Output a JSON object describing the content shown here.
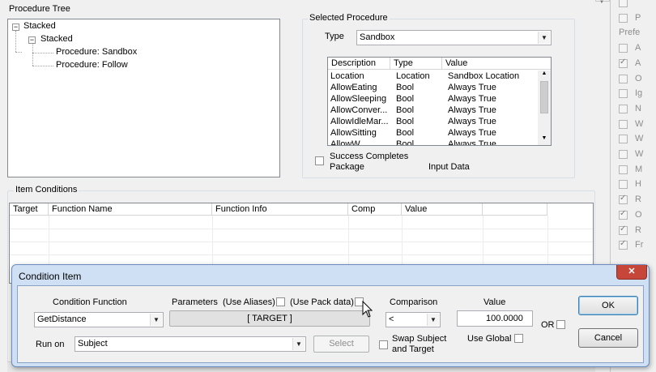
{
  "procedure_tree": {
    "label": "Procedure Tree",
    "nodes": [
      {
        "label": "Stacked",
        "expander": "−"
      },
      {
        "label": "Stacked",
        "expander": "−"
      },
      {
        "label": "Procedure: Sandbox"
      },
      {
        "label": "Procedure: Follow"
      }
    ]
  },
  "selected_procedure": {
    "label": "Selected Procedure",
    "type_label": "Type",
    "type_value": "Sandbox",
    "columns": [
      "Description",
      "Type",
      "Value"
    ],
    "rows": [
      [
        "Location",
        "Location",
        "Sandbox Location"
      ],
      [
        "AllowEating",
        "Bool",
        "Always True"
      ],
      [
        "AllowSleeping",
        "Bool",
        "Always True"
      ],
      [
        "AllowConver...",
        "Bool",
        "Always True"
      ],
      [
        "AllowIdleMar...",
        "Bool",
        "Always True"
      ],
      [
        "AllowSitting",
        "Bool",
        "Always True"
      ],
      [
        "AllowW...",
        "Bool",
        "Always True"
      ]
    ],
    "success_label_1": "Success Completes",
    "success_label_2": "Package",
    "input_data_label": "Input Data"
  },
  "item_conditions": {
    "label": "Item Conditions",
    "columns": [
      "Target",
      "Function Name",
      "Function Info",
      "Comp",
      "Value"
    ]
  },
  "right_panel": {
    "items": [
      {
        "text": "",
        "checked": false
      },
      {
        "text": "P",
        "checked": false
      },
      {
        "text": "Prefe",
        "checked": null
      },
      {
        "text": "A",
        "checked": false
      },
      {
        "text": "A",
        "checked": true
      },
      {
        "text": "O",
        "checked": false
      },
      {
        "text": "Ig",
        "checked": false
      },
      {
        "text": "N",
        "checked": false
      },
      {
        "text": "W",
        "checked": false
      },
      {
        "text": "W",
        "checked": false
      },
      {
        "text": "W",
        "checked": false
      },
      {
        "text": "M",
        "checked": false
      },
      {
        "text": "H",
        "checked": false
      },
      {
        "text": "R",
        "checked": true
      },
      {
        "text": "O",
        "checked": true
      },
      {
        "text": "R",
        "checked": true
      },
      {
        "text": "Fr",
        "checked": true
      }
    ]
  },
  "dialog": {
    "title": "Condition Item",
    "close_glyph": "✕",
    "condition_function_label": "Condition Function",
    "condition_function_value": "GetDistance",
    "parameters_label": "Parameters",
    "use_aliases_label": "(Use Aliases)",
    "use_pack_data_label": "(Use Pack data)",
    "target_button": "[ TARGET ]",
    "comparison_label": "Comparison",
    "comparison_value": "<",
    "value_label": "Value",
    "value_value": "100.0000",
    "or_label": "OR",
    "ok_label": "OK",
    "cancel_label": "Cancel",
    "run_on_label": "Run on",
    "run_on_value": "Subject",
    "select_label": "Select",
    "swap_label_1": "Swap Subject",
    "swap_label_2": "and Target",
    "use_global_label": "Use Global"
  },
  "colors": {
    "dialog_border": "#6d8dbf",
    "dialog_title_bg": "#cfe0f5",
    "close_button": "#c7463a"
  }
}
